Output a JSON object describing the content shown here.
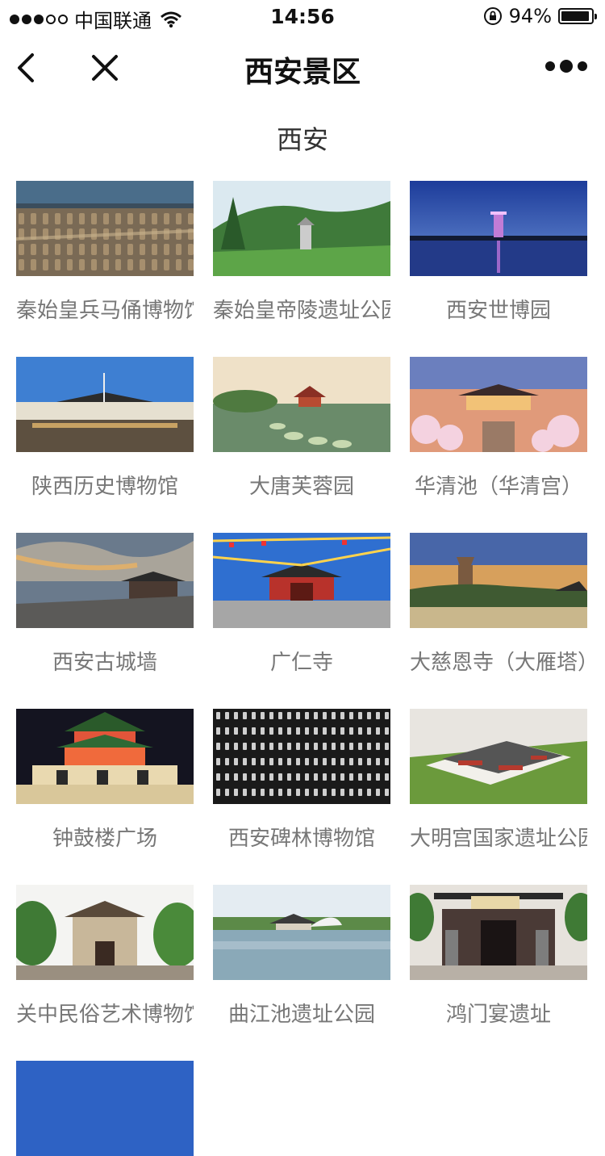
{
  "status": {
    "carrier": "中国联通",
    "time": "14:56",
    "battery": "94%",
    "battery_level": 0.94
  },
  "nav": {
    "title": "西安景区"
  },
  "section": {
    "title": "西安"
  },
  "spots": [
    {
      "label": "秦始皇兵马俑博物馆",
      "scene": "terracotta"
    },
    {
      "label": "秦始皇帝陵遗址公园",
      "scene": "forest"
    },
    {
      "label": "西安世博园",
      "scene": "tower-night"
    },
    {
      "label": "陕西历史博物馆",
      "scene": "museum"
    },
    {
      "label": "大唐芙蓉园",
      "scene": "garden-pond"
    },
    {
      "label": "华清池（华清宫）",
      "scene": "palace-blossom"
    },
    {
      "label": "西安古城墙",
      "scene": "citywall"
    },
    {
      "label": "广仁寺",
      "scene": "temple-flags"
    },
    {
      "label": "大慈恩寺（大雁塔）",
      "scene": "pagoda"
    },
    {
      "label": "钟鼓楼广场",
      "scene": "bell-tower"
    },
    {
      "label": "西安碑林博物馆",
      "scene": "calligraphy"
    },
    {
      "label": "大明宫国家遗址公园",
      "scene": "palace-model"
    },
    {
      "label": "关中民俗艺术博物馆",
      "scene": "folk-gate"
    },
    {
      "label": "曲江池遗址公园",
      "scene": "lake-bridge"
    },
    {
      "label": "鸿门宴遗址",
      "scene": "gate-statues"
    },
    {
      "label": "",
      "scene": "blue-partial"
    }
  ]
}
